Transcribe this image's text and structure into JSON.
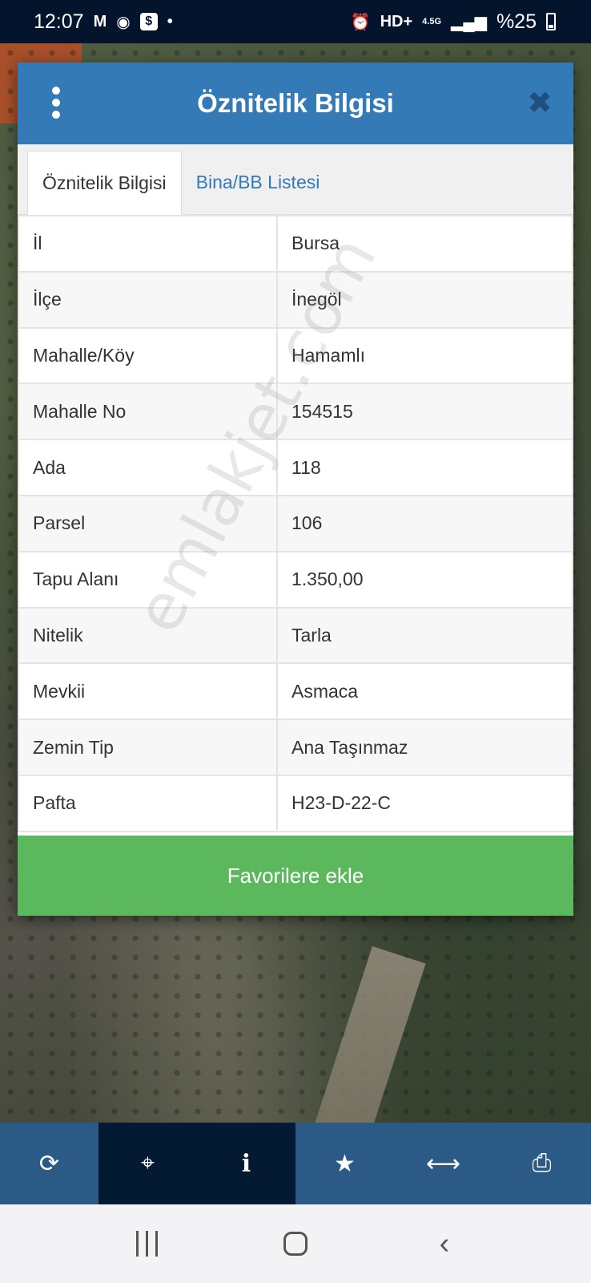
{
  "status_bar": {
    "time": "12:07",
    "network": "HD+",
    "network_gen": "4.5G",
    "battery": "%25",
    "icons": [
      "gmail-icon",
      "messenger-icon",
      "dollar-app-icon",
      "dot-icon",
      "alarm-icon",
      "signal-icon",
      "battery-icon"
    ]
  },
  "modal": {
    "title": "Öznitelik Bilgisi",
    "tabs": [
      {
        "label": "Öznitelik Bilgisi",
        "active": true
      },
      {
        "label": "Bina/BB Listesi",
        "active": false
      }
    ],
    "rows": [
      {
        "key": "İl",
        "value": "Bursa"
      },
      {
        "key": "İlçe",
        "value": "İnegöl"
      },
      {
        "key": "Mahalle/Köy",
        "value": "Hamamlı"
      },
      {
        "key": "Mahalle No",
        "value": "154515"
      },
      {
        "key": "Ada",
        "value": "118"
      },
      {
        "key": "Parsel",
        "value": "106"
      },
      {
        "key": "Tapu Alanı",
        "value": "1.350,00"
      },
      {
        "key": "Nitelik",
        "value": "Tarla"
      },
      {
        "key": "Mevkii",
        "value": "Asmaca"
      },
      {
        "key": "Zemin Tip",
        "value": "Ana Taşınmaz"
      },
      {
        "key": "Pafta",
        "value": "H23-D-22-C"
      }
    ],
    "favorite_button": "Favorilere ekle",
    "watermark": "emlakjet.com"
  },
  "toolbar": {
    "items": [
      "refresh-icon",
      "crosshair-icon",
      "info-icon",
      "star-icon",
      "measure-icon",
      "print-icon"
    ]
  },
  "colors": {
    "header": "#337ab7",
    "favorite": "#5cb85c",
    "toolbar": "#2c5a86",
    "toolbar_active": "#041a33",
    "status_bar": "#03142c"
  }
}
